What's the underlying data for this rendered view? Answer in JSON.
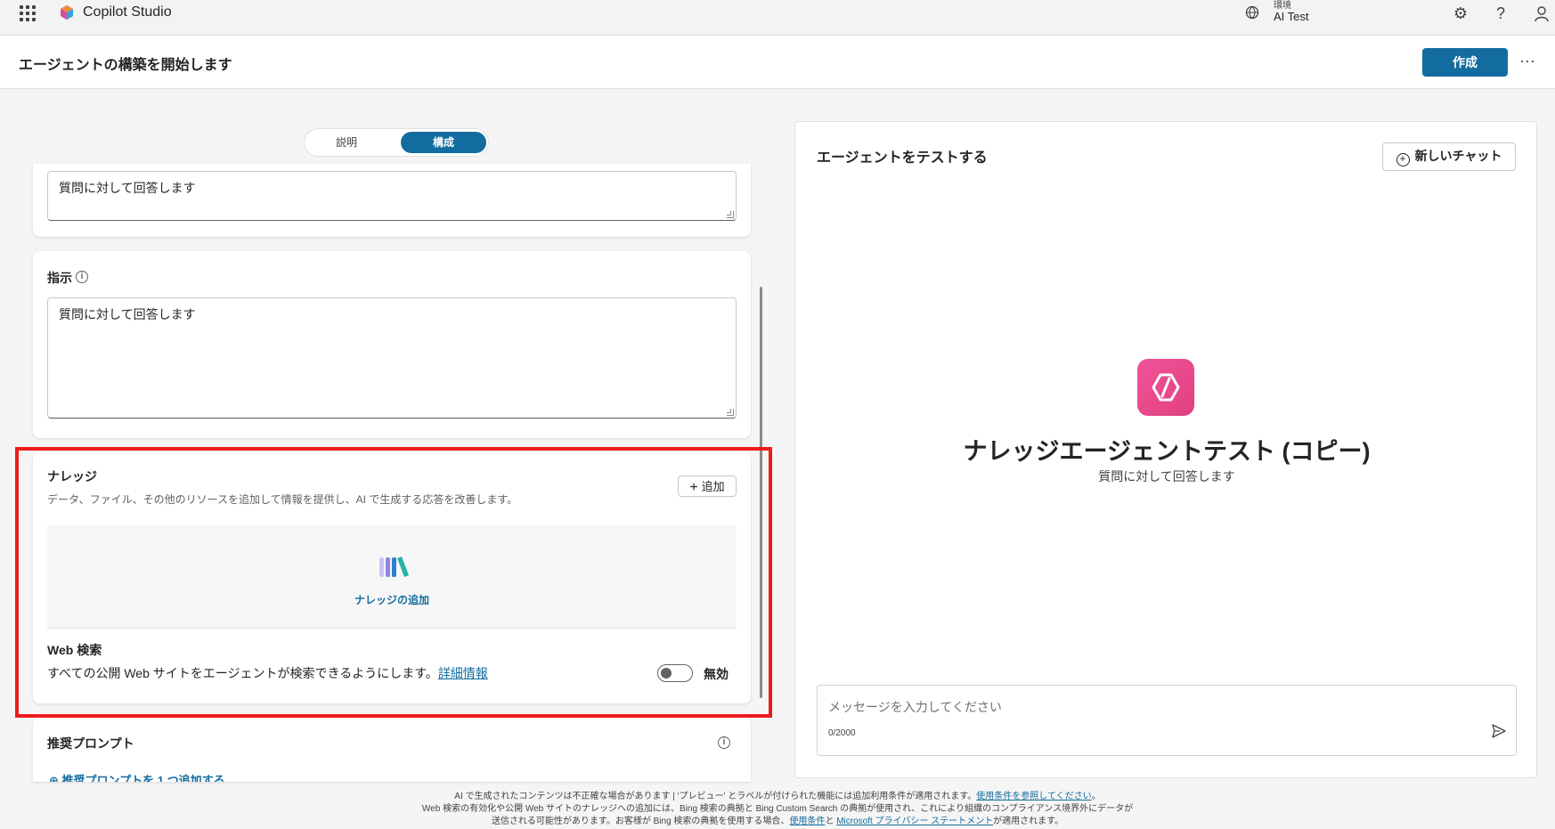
{
  "app": {
    "title": "Copilot Studio"
  },
  "topbar": {
    "env_label": "環境",
    "env_value": "AI Test"
  },
  "header": {
    "title": "エージェントの構築を開始します",
    "create_label": "作成",
    "more_label": "···"
  },
  "tabs": {
    "description": "説明",
    "configure": "構成"
  },
  "description_card": {
    "value": "質問に対して回答します"
  },
  "instructions_card": {
    "title": "指示",
    "value": "質問に対して回答します"
  },
  "knowledge_card": {
    "title": "ナレッジ",
    "description": "データ、ファイル、その他のリソースを追加して情報を提供し、AI で生成する応答を改善します。",
    "add_label": "追加",
    "add_knowledge_label": "ナレッジの追加",
    "web_search_title": "Web 検索",
    "web_search_desc": "すべての公開 Web サイトをエージェントが検索できるようにします。",
    "web_search_link": "詳細情報",
    "toggle_label": "無効",
    "toggle_on": false
  },
  "prompts_card": {
    "title": "推奨プロンプト",
    "add_link": "推奨プロンプトを 1 つ追加する"
  },
  "test_panel": {
    "title": "エージェントをテストする",
    "new_chat_label": "新しいチャット",
    "agent_name": "ナレッジエージェントテスト (コピー)",
    "agent_desc": "質問に対して回答します",
    "input_placeholder": "メッセージを入力してください",
    "char_count": "0/2000"
  },
  "footer": {
    "line1": "AI で生成されたコンテンツは不正確な場合があります | 'プレビュー' とラベルが付けられた機能には追加利用条件が適用されます。",
    "line1_link": "使用条件を参照してください",
    "line2": "Web 検索の有効化や公開 Web サイトのナレッジへの追加には、Bing 検索の典拠と Bing Custom Search の典拠が使用され、これにより組織のコンプライアンス境界外にデータが",
    "line3a": "送信される可能性があります。お客様が Bing 検索の典拠を使用する場合、",
    "line3_link1": "使用条件",
    "line3b": "と",
    "line3_link2": "Microsoft プライバシー ステートメント",
    "line3c": "が適用されます。"
  },
  "colors": {
    "accent": "#136c9f",
    "highlight": "#ef1c1c",
    "agent_icon": "#e8488a"
  }
}
